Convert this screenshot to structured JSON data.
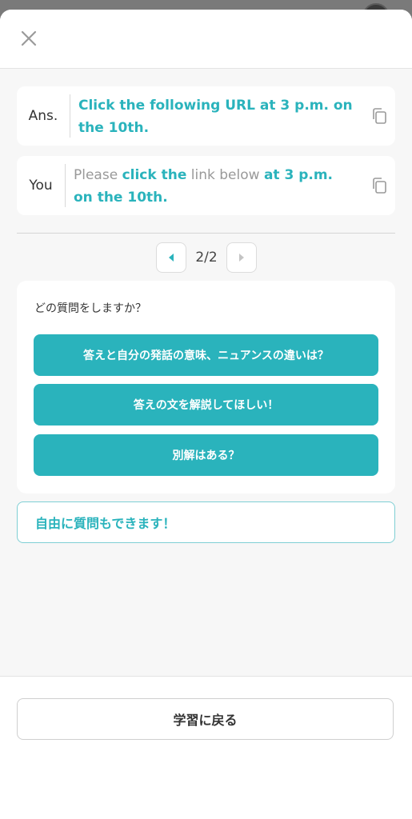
{
  "header": {
    "close_icon": "close-icon"
  },
  "comparison": {
    "answer": {
      "label": "Ans.",
      "text": "Click the following URL at 3 p.m. on the 10th."
    },
    "you": {
      "label": "You",
      "segments": [
        {
          "text": "Please ",
          "highlight": false
        },
        {
          "text": "click the",
          "highlight": true
        },
        {
          "text": " link below ",
          "highlight": false
        },
        {
          "text": "at 3 p.m. on the 10th.",
          "highlight": true
        }
      ]
    },
    "copy_icon": "copy-icon"
  },
  "pager": {
    "current": 2,
    "total": 2,
    "text": "2/2"
  },
  "questions": {
    "prompt": "どの質問をしますか？",
    "options": [
      "答えと自分の発話の意味、ニュアンスの違いは？",
      "答えの文を解説してほしい！",
      "別解はある？"
    ]
  },
  "free_question": {
    "label": "自由に質問もできます！"
  },
  "footer": {
    "back_label": "学習に戻る"
  },
  "colors": {
    "accent": "#2ab3bc",
    "muted_text": "#999999",
    "background": "#f7f7f7"
  }
}
